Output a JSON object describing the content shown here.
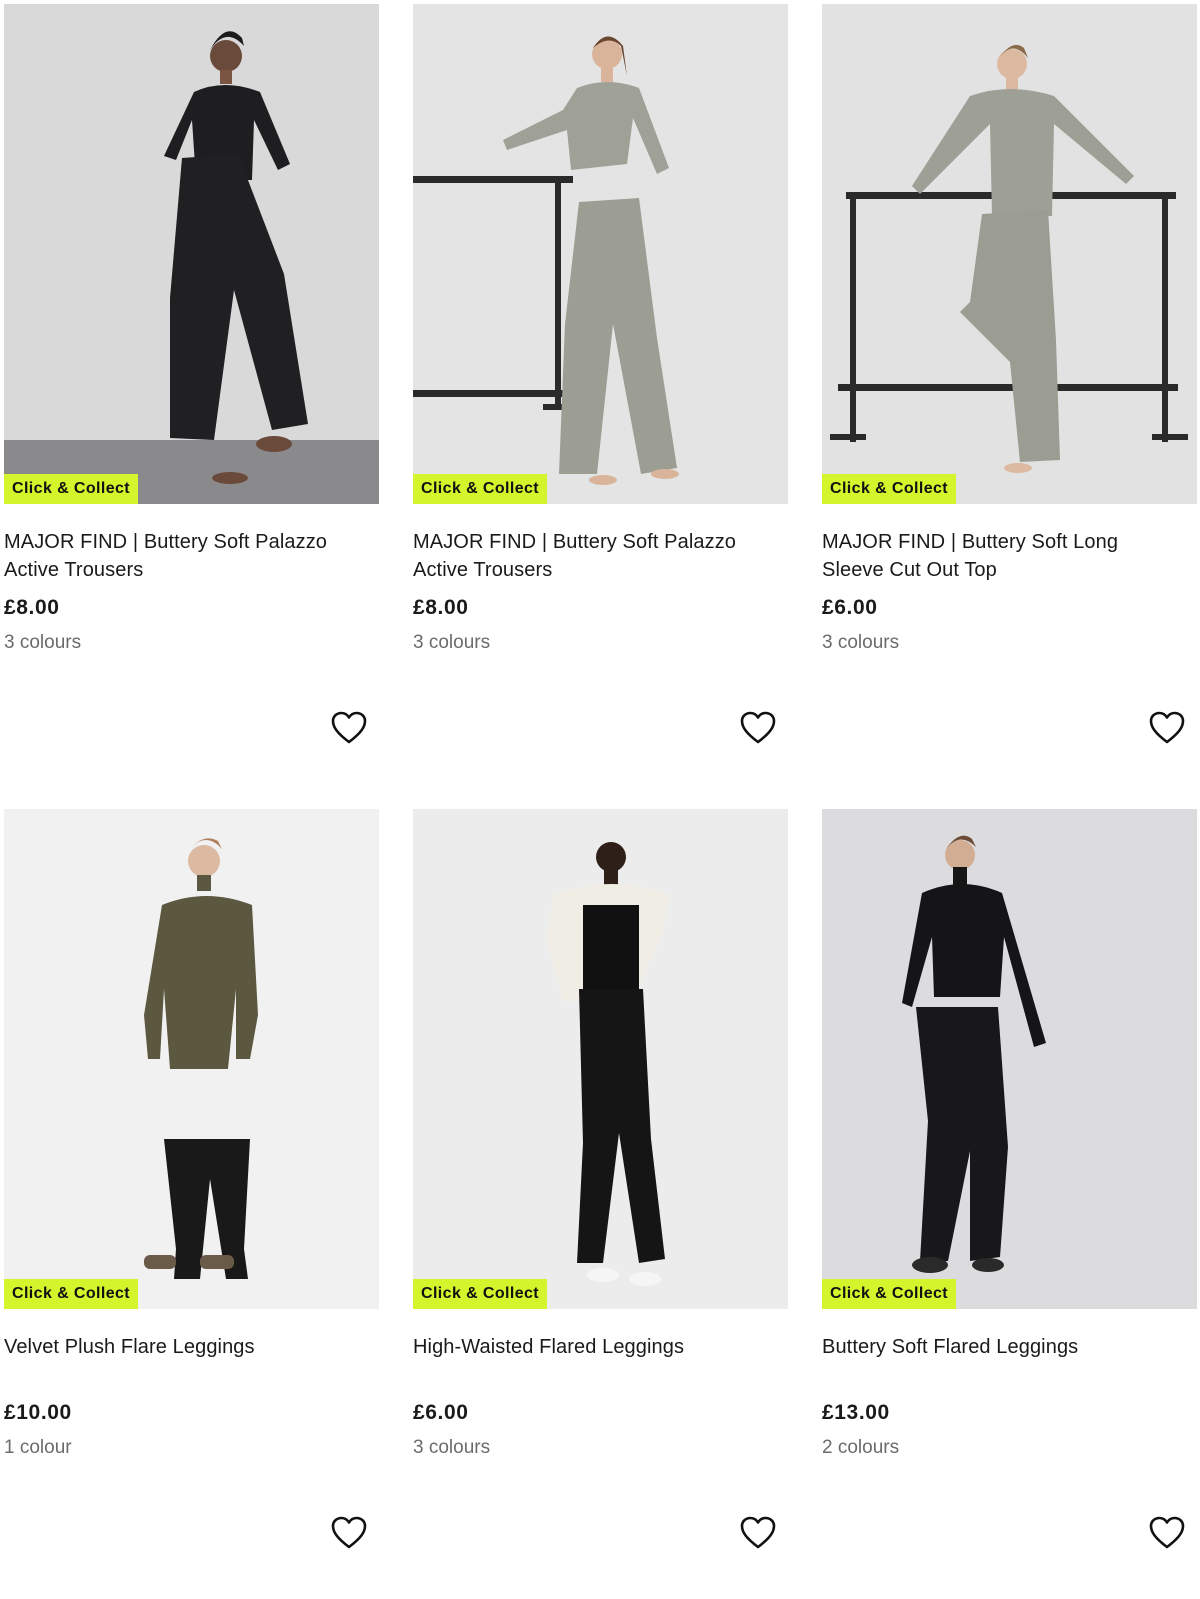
{
  "colors": {
    "badge_bg": "#d4f52b",
    "price": "#1a1a1a",
    "muted": "#6b6b6b"
  },
  "products": [
    {
      "badge": "Click & Collect",
      "title": "MAJOR FIND | Buttery Soft Palazzo Active Trousers",
      "price": "£8.00",
      "colours": "3 colours",
      "image_desc_color": "black",
      "wishlist_icon": "heart-outline-icon"
    },
    {
      "badge": "Click & Collect",
      "title": "MAJOR FIND | Buttery Soft Palazzo Active Trousers",
      "price": "£8.00",
      "colours": "3 colours",
      "image_desc_color": "sage",
      "wishlist_icon": "heart-outline-icon"
    },
    {
      "badge": "Click & Collect",
      "title": "MAJOR FIND | Buttery Soft Long Sleeve Cut Out Top",
      "price": "£6.00",
      "colours": "3 colours",
      "image_desc_color": "sage",
      "wishlist_icon": "heart-outline-icon"
    },
    {
      "badge": "Click & Collect",
      "title": "Velvet Plush Flare Leggings",
      "price": "£10.00",
      "colours": "1 colour",
      "image_desc_color": "black",
      "wishlist_icon": "heart-outline-icon"
    },
    {
      "badge": "Click & Collect",
      "title": "High-Waisted Flared Leggings",
      "price": "£6.00",
      "colours": "3 colours",
      "image_desc_color": "black",
      "wishlist_icon": "heart-outline-icon"
    },
    {
      "badge": "Click & Collect",
      "title": "Buttery Soft Flared Leggings",
      "price": "£13.00",
      "colours": "2 colours",
      "image_desc_color": "black",
      "wishlist_icon": "heart-outline-icon"
    }
  ]
}
